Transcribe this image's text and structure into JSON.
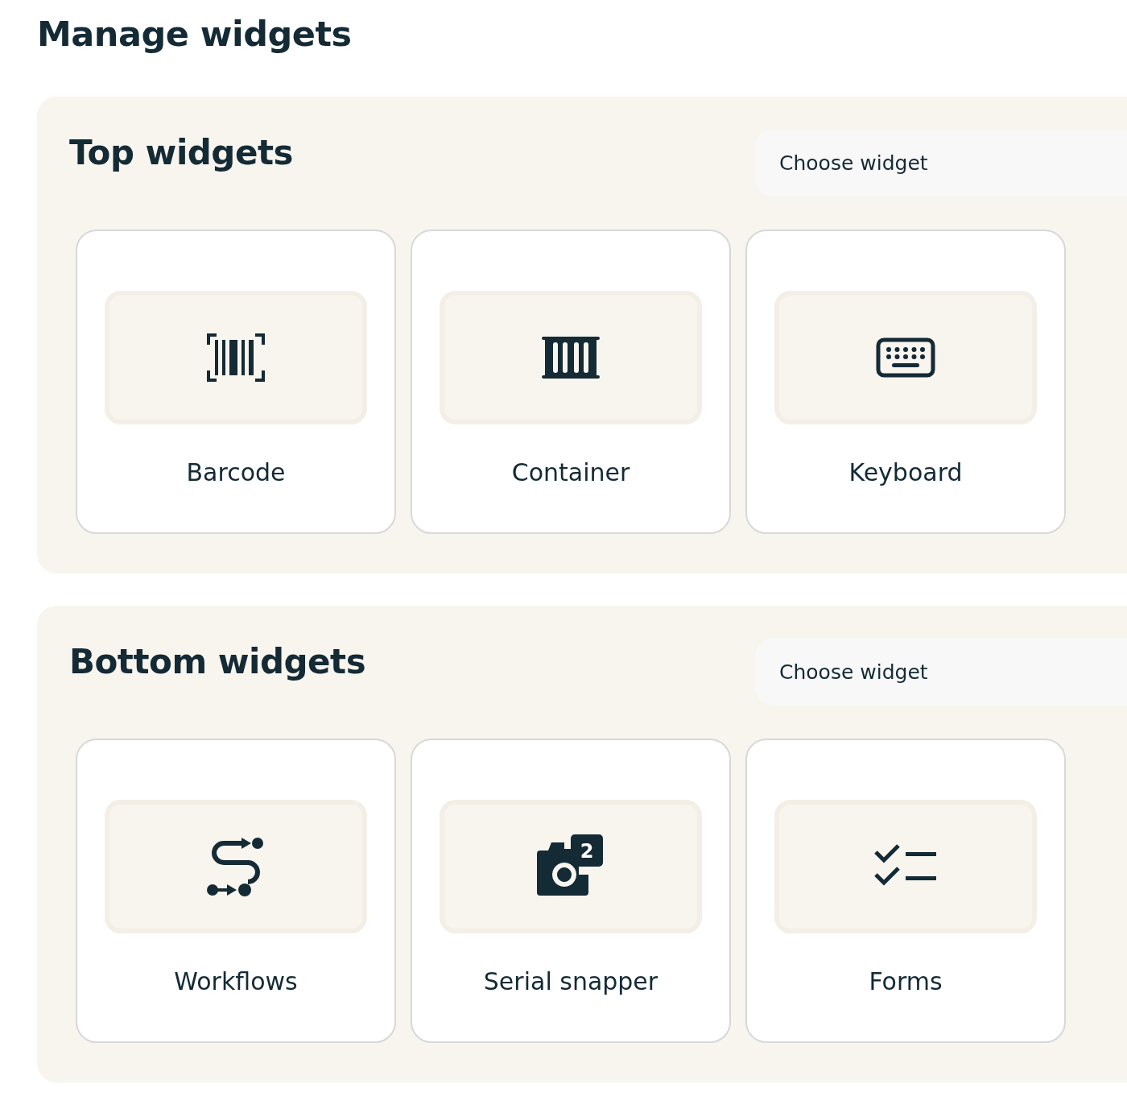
{
  "title": "Manage widgets",
  "sections": [
    {
      "heading": "Top widgets",
      "select": {
        "placeholder": "Choose widget"
      },
      "widgets": [
        {
          "label": "Barcode"
        },
        {
          "label": "Container"
        },
        {
          "label": "Keyboard"
        }
      ]
    },
    {
      "heading": "Bottom widgets",
      "select": {
        "placeholder": "Choose widget"
      },
      "widgets": [
        {
          "label": "Workflows"
        },
        {
          "label": "Serial snapper",
          "badge": "2"
        },
        {
          "label": "Forms"
        }
      ]
    }
  ]
}
